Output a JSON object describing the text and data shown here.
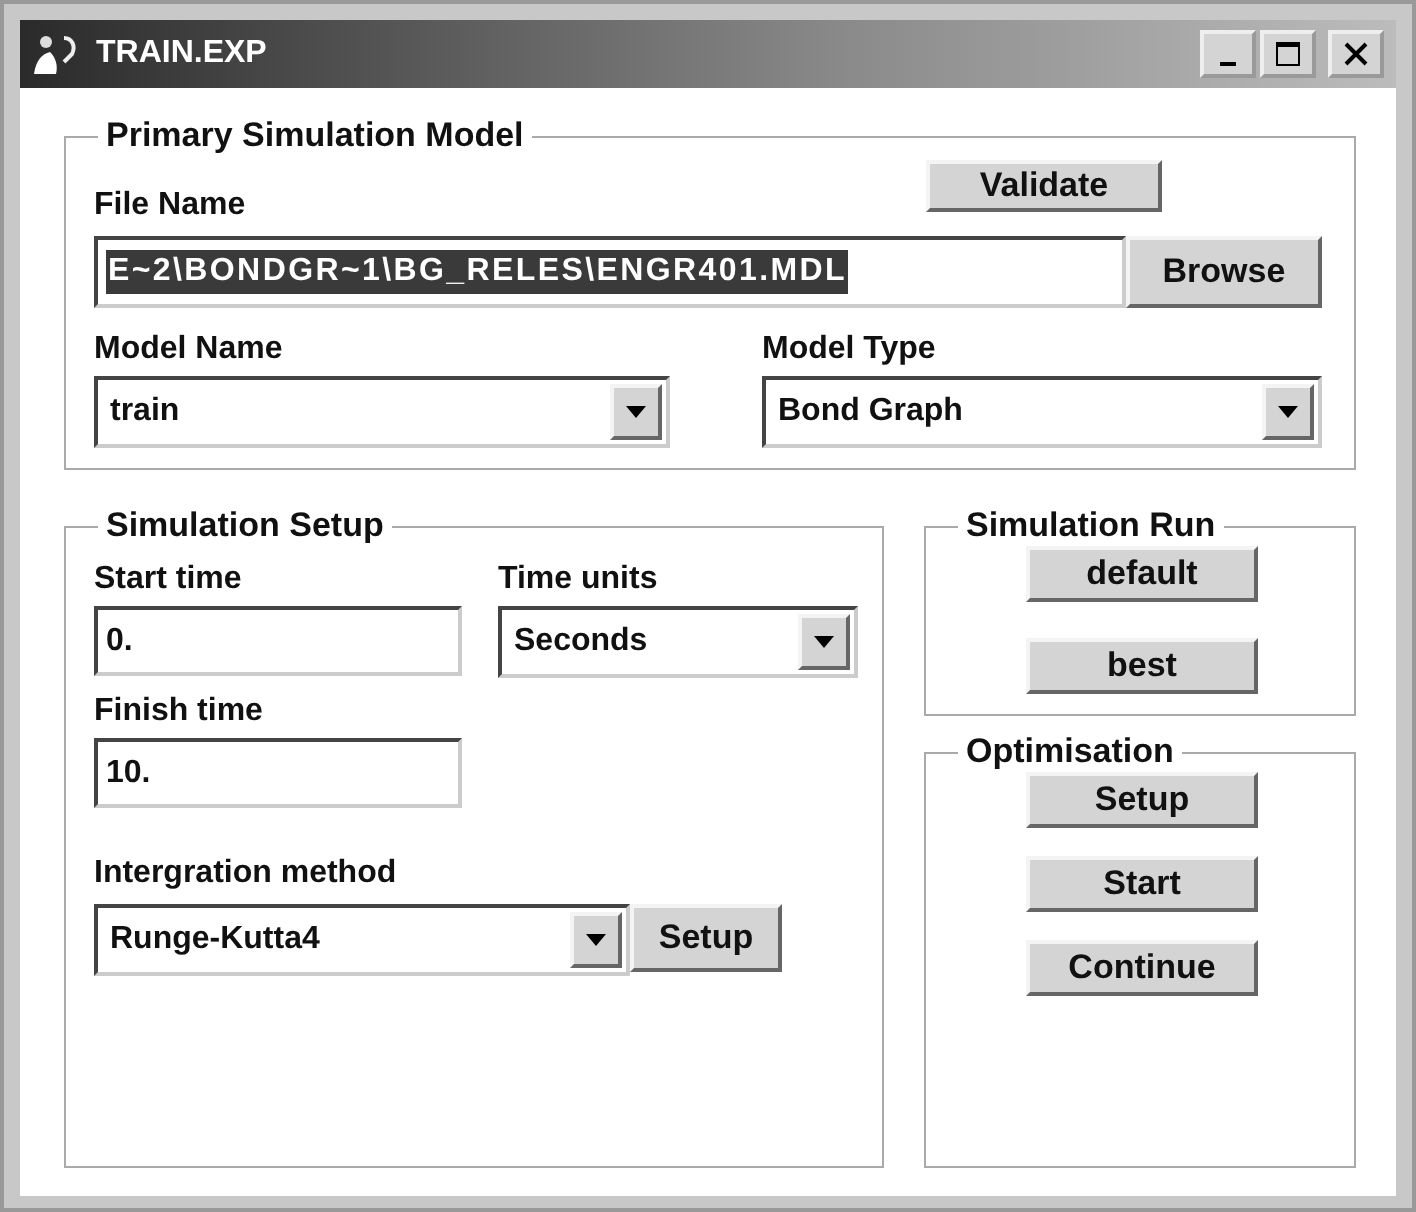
{
  "window": {
    "title": "TRAIN.EXP"
  },
  "primary_model": {
    "title": "Primary Simulation Model",
    "validate_button": "Validate",
    "file_name": {
      "label": "File Name",
      "value": "E~2\\BONDGR~1\\BG_RELES\\ENGR401.MDL",
      "selected": true
    },
    "browse_button": "Browse",
    "model_name": {
      "label": "Model Name",
      "value": "train"
    },
    "model_type": {
      "label": "Model Type",
      "value": "Bond Graph"
    }
  },
  "simulation_setup": {
    "title": "Simulation Setup",
    "start_time": {
      "label": "Start time",
      "value": "0."
    },
    "time_units": {
      "label": "Time units",
      "value": "Seconds"
    },
    "finish_time": {
      "label": "Finish time",
      "value": "10."
    },
    "integration_method": {
      "label": "Intergration method",
      "value": "Runge-Kutta4"
    },
    "setup_button": "Setup"
  },
  "simulation_run": {
    "title": "Simulation Run",
    "buttons": [
      "default",
      "best"
    ]
  },
  "optimisation": {
    "title": "Optimisation",
    "buttons": [
      "Setup",
      "Start",
      "Continue"
    ]
  }
}
